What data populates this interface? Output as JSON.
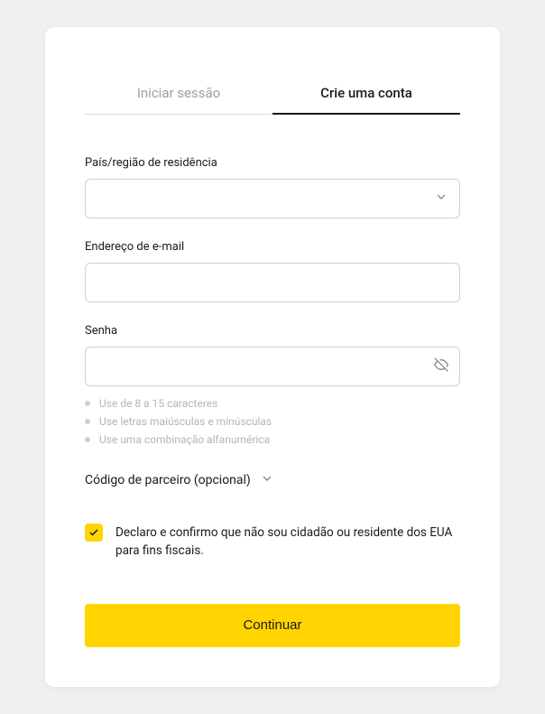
{
  "tabs": {
    "signin": "Iniciar sessão",
    "signup": "Crie uma conta"
  },
  "fields": {
    "country": {
      "label": "País/região de residência",
      "value": ""
    },
    "email": {
      "label": "Endereço de e-mail",
      "value": ""
    },
    "password": {
      "label": "Senha",
      "value": ""
    }
  },
  "hints": [
    "Use de 8 a 15 caracteres",
    "Use letras maiúsculas e minúsculas",
    "Use uma combinação alfanumérica"
  ],
  "partner": {
    "label": "Código de parceiro (opcional)"
  },
  "declaration": {
    "checked": true,
    "text": "Declaro e confirmo que não sou cidadão ou residente dos EUA para fins fiscais."
  },
  "cta": {
    "label": "Continuar"
  },
  "colors": {
    "accent": "#ffd400"
  }
}
